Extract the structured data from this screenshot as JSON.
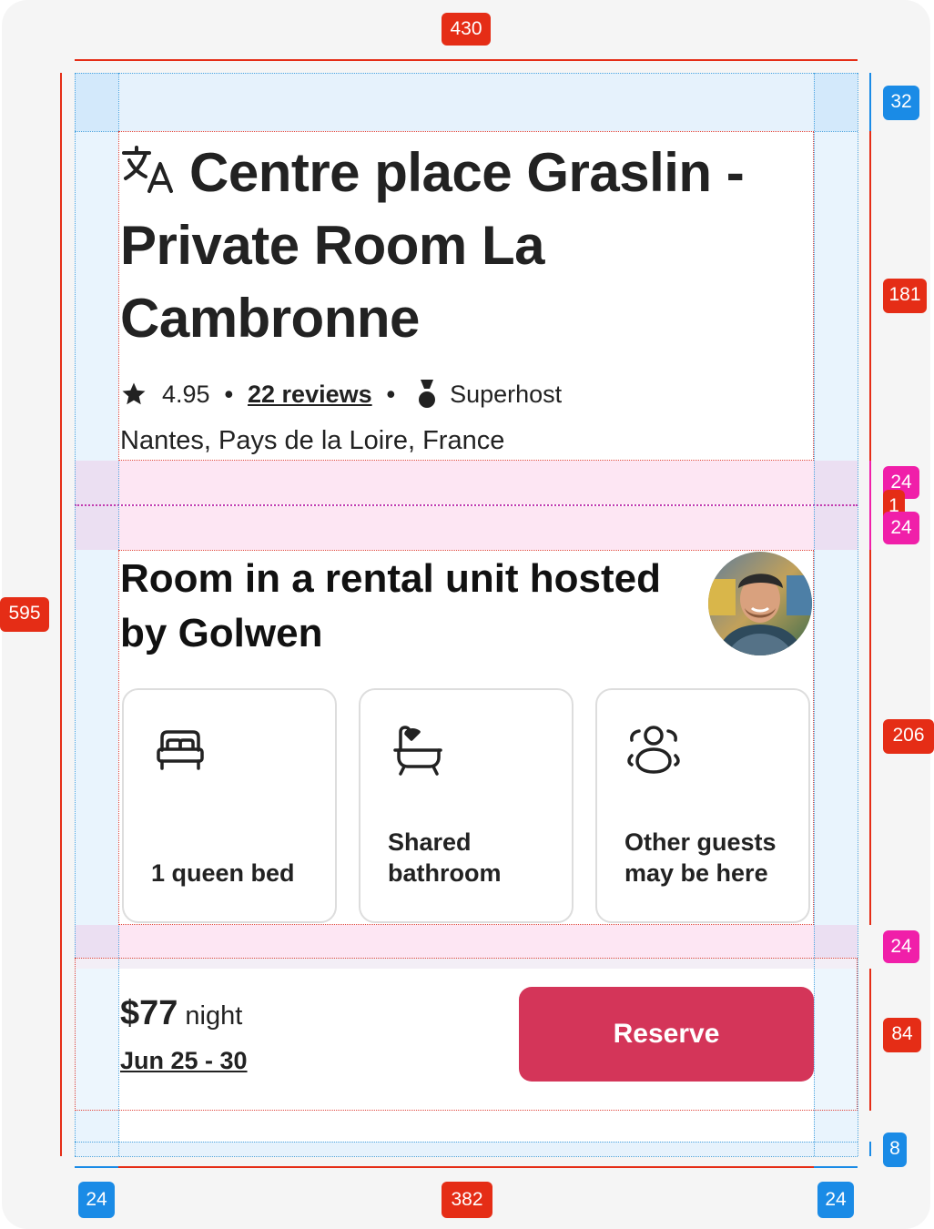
{
  "listing": {
    "title": "Centre place Graslin - Private Room La Cambronne",
    "rating": "4.95",
    "reviews_label": "22 reviews",
    "superhost_label": "Superhost",
    "location": "Nantes, Pays de la Loire, France"
  },
  "host": {
    "heading": "Room in a rental unit hosted by Golwen"
  },
  "highlights": [
    {
      "label": "1 queen bed",
      "icon": "bed-icon"
    },
    {
      "label": "Shared bathroom",
      "icon": "bathtub-icon"
    },
    {
      "label": "Other guests may be here",
      "icon": "guests-icon"
    }
  ],
  "booking": {
    "price": "$77",
    "unit": "night",
    "dates": "Jun 25 - 30",
    "reserve_label": "Reserve"
  },
  "annotations": {
    "width_total": "430",
    "top_padding": "32",
    "header_height": "181",
    "gap_a": "24",
    "divider": "1",
    "gap_b": "24",
    "total_height": "595",
    "section_height": "206",
    "gap_c": "24",
    "footer_height": "84",
    "bottom_padding": "8",
    "left_padding": "24",
    "content_width": "382",
    "right_padding": "24"
  },
  "colors": {
    "accent": "#d43559",
    "text": "#222222",
    "card_border": "#dddddd"
  }
}
